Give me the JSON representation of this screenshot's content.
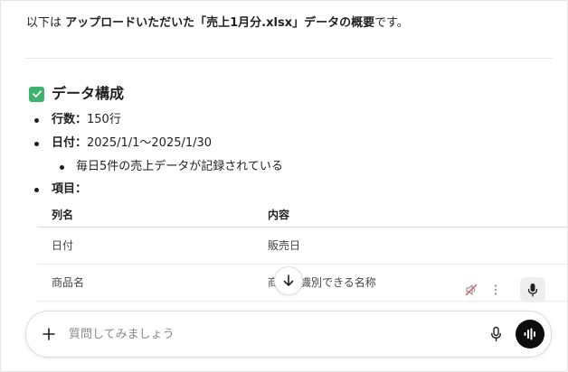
{
  "message": {
    "intro_before": "以下は ",
    "intro_bold": "アップロードいただいた「売上1月分.xlsx」データの概要",
    "intro_after": "です。",
    "section_title": "データ構成",
    "rows_label": "行数：",
    "rows_value": "150行",
    "date_label": "日付：",
    "date_value": "2025/1/1〜2025/1/30",
    "date_note": "毎日5件の売上データが記録されている",
    "items_label": "項目："
  },
  "table": {
    "headers": [
      "列名",
      "内容"
    ],
    "rows": [
      [
        "日付",
        "販売日"
      ],
      [
        "商品名",
        "商品を識別できる名称"
      ]
    ]
  },
  "composer": {
    "placeholder": "質問してみましょう",
    "value": ""
  },
  "colors": {
    "check_green": "#3cb46e",
    "voice_button": "#0d0d0d"
  },
  "icons": [
    "check-icon",
    "arrow-down-icon",
    "mute-icon",
    "more-vertical-icon",
    "microphone-icon",
    "plus-icon",
    "voice-wave-icon"
  ]
}
